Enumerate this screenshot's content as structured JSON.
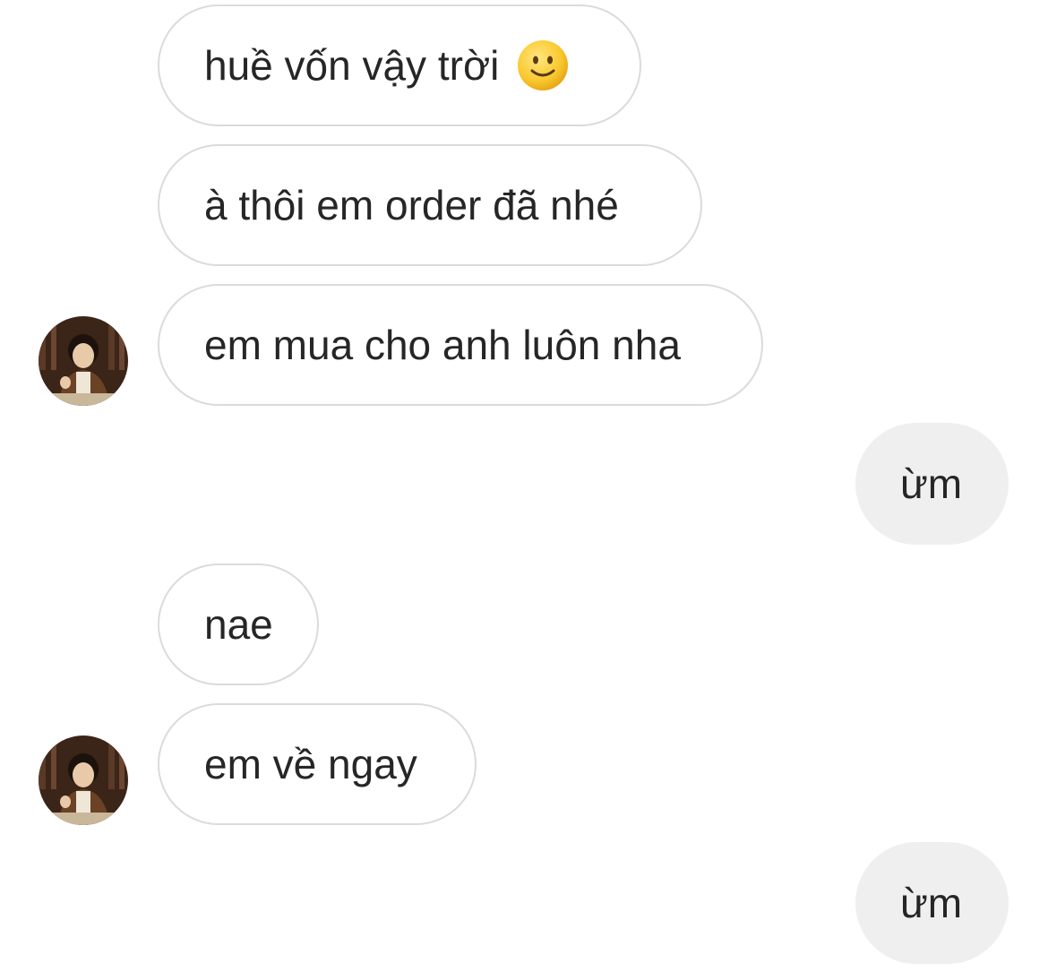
{
  "messages": [
    {
      "side": "in",
      "text": "huề vốn vậy trời",
      "emoji": "slightly-smiling-face-icon"
    },
    {
      "side": "in",
      "text": "à thôi em order đã nhé"
    },
    {
      "side": "in",
      "text": "em mua cho anh luôn nha",
      "avatar": "contact-avatar"
    },
    {
      "side": "out",
      "text": "ừm"
    },
    {
      "side": "in",
      "text": "nae"
    },
    {
      "side": "in",
      "text": "em về ngay",
      "avatar": "contact-avatar"
    },
    {
      "side": "out",
      "text": "ừm"
    }
  ],
  "colors": {
    "incoming_bg": "#ffffff",
    "incoming_border": "#dbdbdb",
    "outgoing_bg": "#efefef",
    "text": "#262626"
  }
}
